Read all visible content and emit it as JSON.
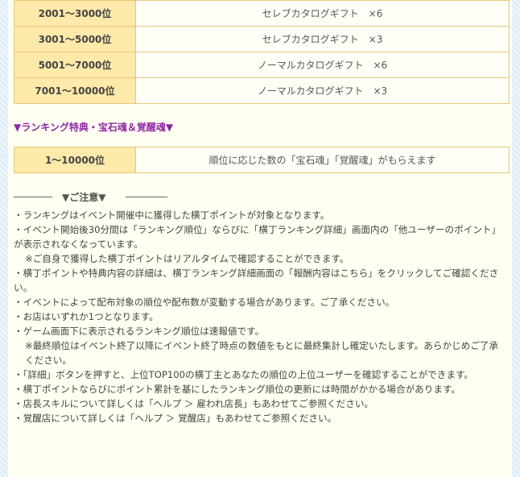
{
  "ranking_rewards": [
    {
      "rank": "2001〜3000位",
      "reward": "セレブカタログギフト　×6"
    },
    {
      "rank": "3001〜5000位",
      "reward": "セレブカタログギフト　×3"
    },
    {
      "rank": "5001〜7000位",
      "reward": "ノーマルカタログギフト　×6"
    },
    {
      "rank": "7001〜10000位",
      "reward": "ノーマルカタログギフト　×3"
    }
  ],
  "bonus_section": {
    "title": "▼ランキング特典・宝石魂＆覚醒魂▼",
    "rank": "1〜10000位",
    "description": "順位に応じた数の「宝石魂」「覚醒魂」がもらえます"
  },
  "notice": {
    "heading": "▼ご注意▼",
    "lines": [
      "・ランキングはイベント開催中に獲得した横丁ポイントが対象となります。",
      "・イベント開始後30分間は「ランキング順位」ならびに「横丁ランキング詳細」画面内の「他ユーザーのポイント」が表示されなくなっています。",
      "※ご自身で獲得した横丁ポイントはリアルタイムで確認することができます。",
      "・横丁ポイントや特典内容の詳細は、横丁ランキング詳細画面の「報酬内容はこちら」をクリックしてご確認ください。",
      "・イベントによって配布対象の順位や配布数が変動する場合があります。ご了承ください。",
      "・お店はいずれか1つとなります。",
      "・ゲーム画面下に表示されるランキング順位は速報値です。",
      "※最終順位はイベント終了以降にイベント終了時点の数値をもとに最終集計し確定いたします。あらかじめご了承ください。",
      "・「詳細」ボタンを押すと、上位TOP100の横丁主とあなたの順位の上位ユーザーを確認することができます。",
      "・横丁ポイントならびにポイント累計を基にしたランキング順位の更新には時間がかかる場合があります。",
      "・店長スキルについて詳しくは「ヘルプ ＞ 雇われ店長」もあわせてご参照ください。",
      "・覚醒店について詳しくは「ヘルプ ＞ 覚醒店」もあわせてご参照ください。"
    ]
  },
  "colors": {
    "rank_cell_bg": "#fde9a9",
    "table_border": "#e6c875",
    "section_title": "#8e27a5",
    "panel_bg": "#fffff2",
    "outer_bg": "#dfeef8"
  }
}
